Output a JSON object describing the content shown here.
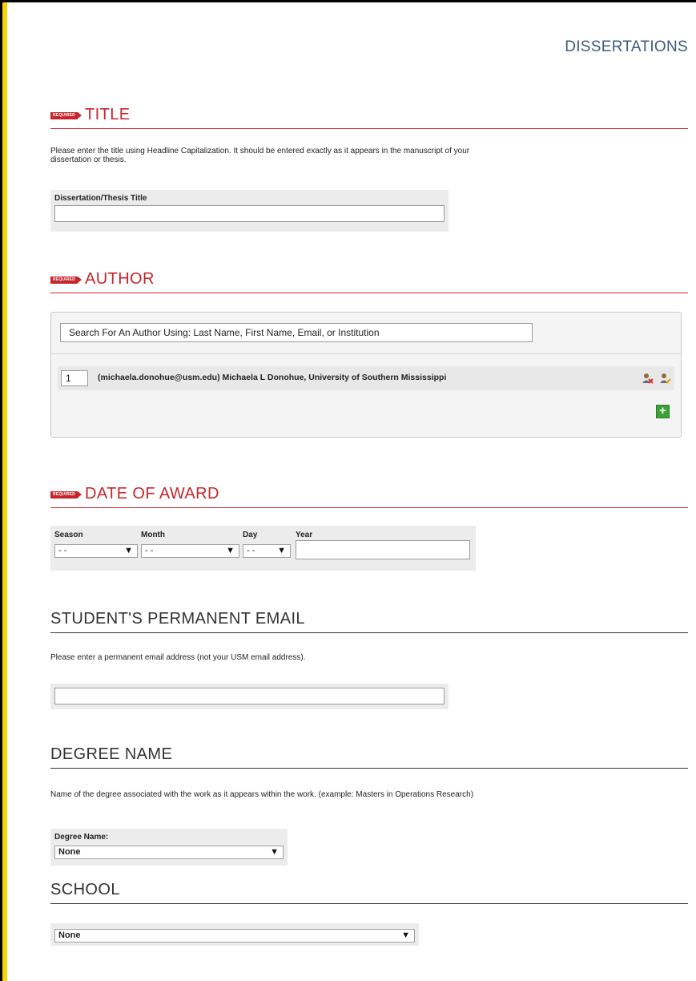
{
  "page": {
    "header": "DISSERTATIONS"
  },
  "colors": {
    "accent_red": "#c7252c",
    "yellow_bar": "#f5d20a",
    "header_blue": "#3d5a7a",
    "add_green": "#3aa335"
  },
  "required_tag": "REQUIRED",
  "title_section": {
    "heading": "TITLE",
    "help": "Please enter the title using Headline Capitalization. It should be entered exactly as it appears in the manuscript of your dissertation or thesis.",
    "field_label": "Dissertation/Thesis Title",
    "value": ""
  },
  "author_section": {
    "heading": "AUTHOR",
    "search_placeholder": "Search For An Author Using: Last Name, First Name, Email, or Institution",
    "authors": [
      {
        "position": "1",
        "text": "(michaela.donohue@usm.edu) Michaela L Donohue, University of Southern Mississippi"
      }
    ],
    "icons": {
      "remove": "remove-author-icon",
      "edit": "edit-author-icon",
      "add": "add-author-icon"
    },
    "add_label": "+"
  },
  "date_section": {
    "heading": "DATE OF AWARD",
    "season": {
      "label": "Season",
      "value": "- -"
    },
    "month": {
      "label": "Month",
      "value": "- -"
    },
    "day": {
      "label": "Day",
      "value": "- -"
    },
    "year": {
      "label": "Year",
      "value": ""
    }
  },
  "email_section": {
    "heading": "STUDENT'S PERMANENT EMAIL",
    "help": "Please enter a permanent email address (not your USM email address).",
    "value": ""
  },
  "degree_section": {
    "heading": "DEGREE NAME",
    "help": "Name of the degree associated with the work as it appears within the work. (example: Masters in Operations Research)",
    "field_label": "Degree Name:",
    "value": "None"
  },
  "school_section": {
    "heading": "SCHOOL",
    "value": "None"
  },
  "arrow_glyph": "▼"
}
